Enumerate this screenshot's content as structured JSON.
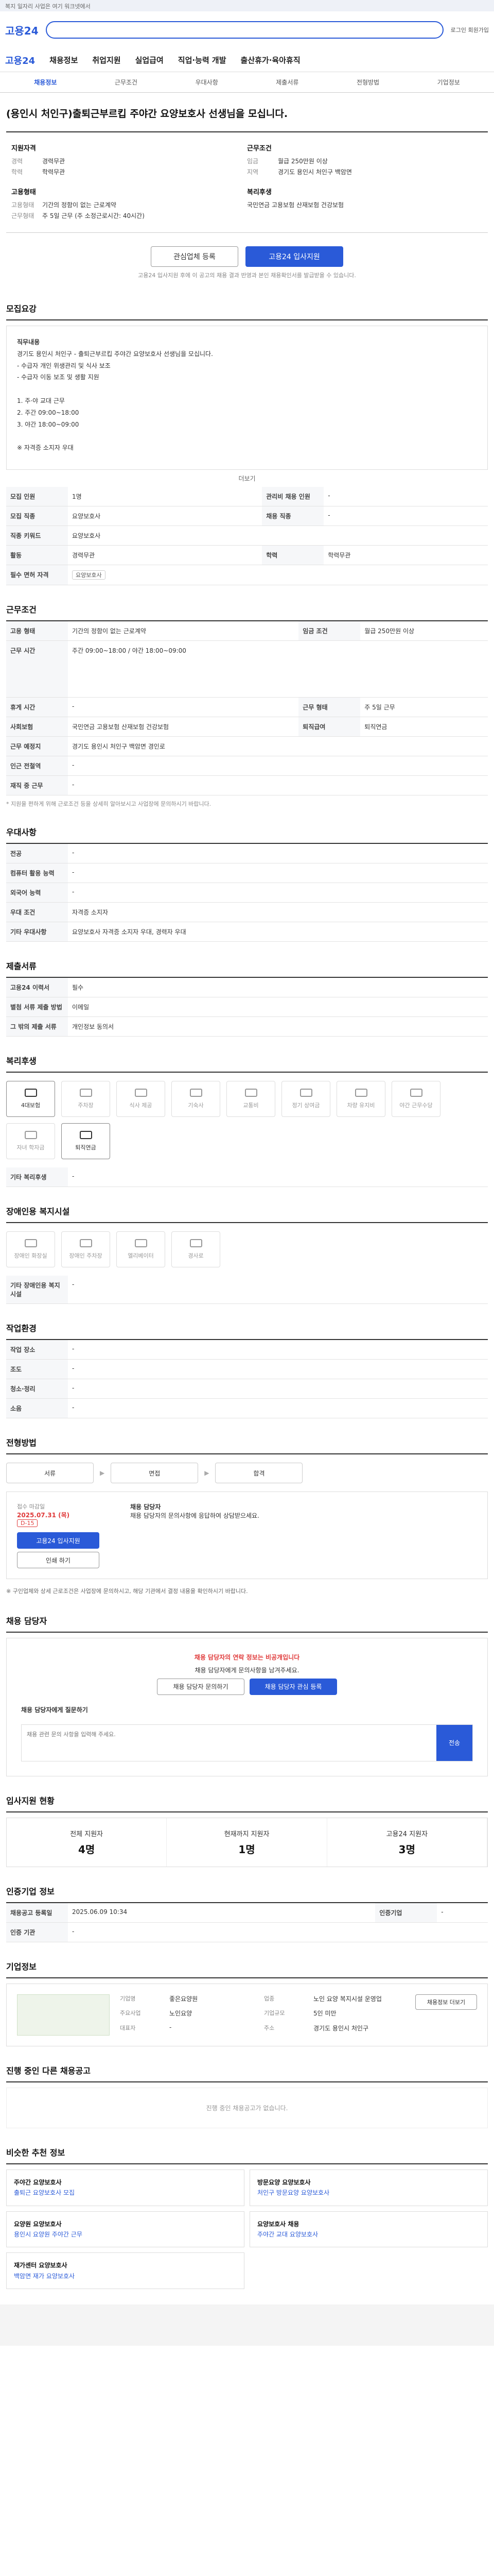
{
  "site": {
    "logo": "고용24",
    "topbar": "복지 일자리 사업은 여기 워크넷에서",
    "nav": [
      "채용정보",
      "취업지원",
      "실업급여",
      "직업·능력 개발",
      "출산휴가·육아휴직"
    ],
    "hdr_right": "로그인 회원가입"
  },
  "subnav": [
    "채용정보",
    "근무조건",
    "우대사항",
    "제출서류",
    "전형방법",
    "기업정보"
  ],
  "job": {
    "title": "(용인시 처인구)출퇴근부르킵 주야간 요양보호사 선생님을 모십니다.",
    "left_head": "지원자격",
    "right_head": "근무조건",
    "left": [
      [
        "경력",
        "경력무관"
      ],
      [
        "학력",
        "학력무관"
      ]
    ],
    "right": [
      [
        "임금",
        "월급 250만원 이상"
      ],
      [
        "지역",
        "경기도 용인시 처인구 백암면"
      ]
    ],
    "left2_head": "고용형태",
    "left2": [
      [
        "고용형태",
        "기간의 정함이 없는 근로계약"
      ],
      [
        "근무형태",
        "주 5일 근무 (주 소정근로시간: 40시간)"
      ]
    ],
    "right2_head": "복리후생",
    "right2": [
      [
        "",
        "국민연금 고용보험 산재보험 건강보험"
      ]
    ],
    "btn_scrap": "관심업체 등록",
    "btn_apply": "고용24 입사지원",
    "note": "고용24 입사지원 후에 이 공고의 채용 결과 반영과 본인 채용확인서를 발급받을 수 있습니다."
  },
  "recruit": {
    "sec": "모집요강",
    "body": [
      "직무내용",
      "경기도 용인시 처인구 - 출퇴근부르킵 주야간 요양보호사 선생님을 모십니다.",
      "- 수급자 개인 위생관리 및 식사 보조",
      "- 수급자 이동 보조 및 생활 지원",
      "",
      "1. 주·야 교대 근무",
      "2. 주간 09:00~18:00",
      "3. 야간 18:00~09:00",
      "",
      "※ 자격증 소지자 우대"
    ],
    "more": "더보기"
  },
  "rows1": [
    [
      "모집 인원",
      "1명",
      "관리비 채용 인원",
      "-"
    ],
    [
      "모집 직종",
      "요양보호사",
      "채용 직종",
      "-"
    ],
    [
      "직종 키워드",
      "요양보호사",
      "",
      ""
    ],
    [
      "활동",
      "경력무관",
      "학력",
      "학력무관"
    ],
    [
      "필수 면허 자격",
      "요양보호사",
      "",
      ""
    ]
  ],
  "cond": {
    "sec": "근무조건",
    "rows": [
      [
        "고용 형태",
        "기간의 정함이 없는 근로계약",
        "임금 조건",
        "월급 250만원 이상"
      ],
      [
        "근무 시간",
        "주간 09:00~18:00 / 야간 18:00~09:00",
        "",
        ""
      ],
      [
        "휴게 시간",
        "-",
        "근무 형태",
        "주 5일 근무"
      ],
      [
        "사회보험",
        "국민연금 고용보험 산재보험 건강보험",
        "퇴직급여",
        "퇴직연금"
      ],
      [
        "근무 예정지",
        "경기도 용인시 처인구 백암면 경인로 ",
        "",
        ""
      ],
      [
        "인근 전철역",
        "-",
        "",
        ""
      ],
      [
        "재직 중 근무",
        "-",
        "",
        ""
      ]
    ],
    "note": "* 지원을 편하게 위해 근로조건 등을 상세히 알아보시고 사업장에 문의하시기 바랍니다."
  },
  "pref": {
    "sec": "우대사항",
    "rows": [
      [
        "전공",
        "-"
      ],
      [
        "컴퓨터 활용 능력",
        "-"
      ],
      [
        "외국어 능력",
        "-"
      ],
      [
        "우대 조건",
        "자격증 소지자"
      ],
      [
        "기타 우대사항",
        "요양보호사 자격증 소지자 우대, 경력자 우대"
      ]
    ]
  },
  "docs": {
    "sec": "제출서류",
    "rows": [
      [
        "고용24 이력서",
        "필수"
      ],
      [
        "별첨 서류 제출 방법",
        "이메일"
      ],
      [
        "그 밖의 제출 서류",
        "개인정보 동의서"
      ]
    ]
  },
  "welfare": {
    "sec": "복리후생",
    "items": [
      "4대보험",
      "주차장",
      "식사 제공",
      "기숙사",
      "교통비",
      "정기 상여금",
      "차량 유지비",
      "야간 근무수당",
      "자녀 학자금",
      "퇴직연금",
      "주5일 근무",
      "연차"
    ],
    "extra_label": "기타 복리후생",
    "extra": "-"
  },
  "disabled": {
    "sec": "장애인용 복지시설",
    "items": [
      "장애인 화장실",
      "장애인 주차장",
      "엘리베이터",
      "경사로"
    ],
    "label": "기타 장애인용 복지시설",
    "value": "-"
  },
  "env": {
    "sec": "작업환경",
    "rows": [
      [
        "작업 장소",
        "-",
        "",
        ""
      ],
      [
        "조도",
        "-",
        "",
        "-"
      ],
      [
        "청소·정리",
        "-",
        "",
        ""
      ],
      [
        "소음",
        "-",
        "",
        ""
      ]
    ]
  },
  "process": {
    "sec": "전형방법",
    "steps": [
      "서류",
      "면접",
      "합격"
    ],
    "date_label": "접수 마감일",
    "date": "2025.07.31 (목)",
    "dday": "D-15",
    "mgr_head": "채용 담당자",
    "mgr_text": "채용 담당자의 문의사항에 응답하여 상담받으세요.",
    "apply": "고용24 입사지원",
    "print": "인쇄 하기",
    "warn": "※ 구인업체와 상세 근로조건은 사업장에 문의하시고, 해당 기관에서 결정 내용을 확인하시기 바랍니다."
  },
  "manager": {
    "sec": "채용 담당자",
    "alert": "채용 담당자의 연락 정보는 비공개입니다",
    "text": "채용 담당자에게 문의사항을 남겨주세요.",
    "b1": "채용 담당자 문의하기",
    "b2": "채용 담당자 관심 등록",
    "q_label": "채용 담당자에게 질문하기",
    "q_ph": "채용 관련 문의 사항을 입력해 주세요.",
    "q_btn": "전송"
  },
  "stats": {
    "sec": "입사지원 현황",
    "items": [
      [
        "전체 지원자",
        "4명"
      ],
      [
        "현재까지 지원자",
        "1명"
      ],
      [
        "고용24 지원자",
        "3명"
      ]
    ]
  },
  "contract": {
    "sec": "인증기업 정보",
    "rows": [
      [
        "채용공고 등록일",
        "2025.06.09 10:34",
        "인증기업",
        "-"
      ],
      [
        "인증 기관",
        "-",
        "",
        "-"
      ]
    ]
  },
  "company": {
    "sec": "기업정보",
    "rows": [
      [
        "기업명",
        "좋은요양원"
      ],
      [
        "업종",
        "노인 요양 복지시설 운영업"
      ],
      [
        "주요사업",
        "노인요양"
      ],
      [
        "기업규모",
        "5인 미만"
      ],
      [
        "대표자",
        "-"
      ],
      [
        "주소",
        "경기도 용인시 처인구"
      ]
    ],
    "btn": "채용정보 더보기"
  },
  "others": {
    "sec": "진행 중인 다른 채용공고",
    "empty": "진행 중인 채용공고가 없습니다."
  },
  "recommend": {
    "sec": "비슷한 추천 정보",
    "cards": [
      [
        "주야간 요양보호사",
        "출퇴근 요양보호사 모집"
      ],
      [
        "방문요양 요양보호사",
        "처인구 방문요양 요양보호사"
      ],
      [
        "요양원 요양보호사",
        "용인시 요양원 주야간 근무"
      ],
      [
        "요양보호사 채용",
        "주야간 교대 요양보호사"
      ],
      [
        "재가센터 요양보호사",
        "백암면 재가 요양보호사"
      ]
    ]
  }
}
